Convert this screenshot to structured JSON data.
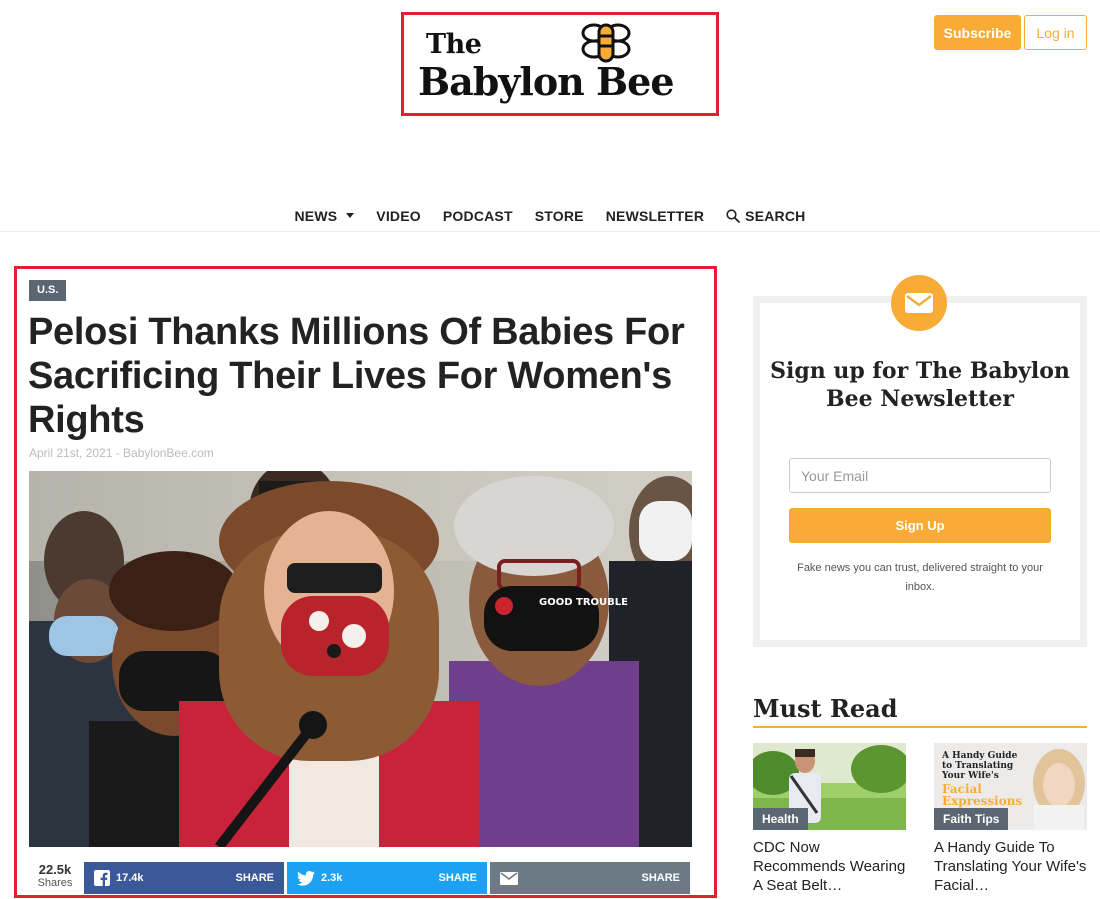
{
  "header": {
    "logo_line1": "The",
    "logo_line2": "Babylon Bee",
    "subscribe_label": "Subscribe",
    "login_label": "Log in"
  },
  "nav": {
    "items": [
      {
        "label": "NEWS",
        "dropdown": true
      },
      {
        "label": "VIDEO"
      },
      {
        "label": "PODCAST"
      },
      {
        "label": "STORE"
      },
      {
        "label": "NEWSLETTER"
      },
      {
        "label": "SEARCH",
        "icon": "search-icon"
      }
    ]
  },
  "article": {
    "category": "U.S.",
    "headline": "Pelosi Thanks Millions Of Babies For Sacrificing Their Lives For Women's Rights",
    "byline": "April 21st, 2021 - BabylonBee.com",
    "mask_text": "GOOD TROUBLE",
    "shares": {
      "total": "22.5k",
      "total_label": "Shares",
      "facebook": {
        "count": "17.4k",
        "label": "SHARE"
      },
      "twitter": {
        "count": "2.3k",
        "label": "SHARE"
      },
      "email": {
        "label": "SHARE"
      }
    }
  },
  "newsletter": {
    "title": "Sign up for The Babylon Bee Newsletter",
    "email_placeholder": "Your Email",
    "button_label": "Sign Up",
    "note": "Fake news you can trust, delivered straight to your inbox."
  },
  "must_read": {
    "title": "Must Read",
    "items": [
      {
        "category": "Health",
        "title": "CDC Now Recommends Wearing A Seat Belt…"
      },
      {
        "category": "Faith Tips",
        "title": "A Handy Guide To Translating Your Wife's Facial…",
        "thumb_title": "A Handy Guide to Translating Your Wife's",
        "thumb_highlight": "Facial Expressions"
      }
    ]
  },
  "colors": {
    "brand_orange": "#f8ac36",
    "highlight_red": "#e3202f",
    "tag_gray": "#5a6671",
    "facebook": "#3b5998",
    "twitter": "#1da1f2"
  }
}
